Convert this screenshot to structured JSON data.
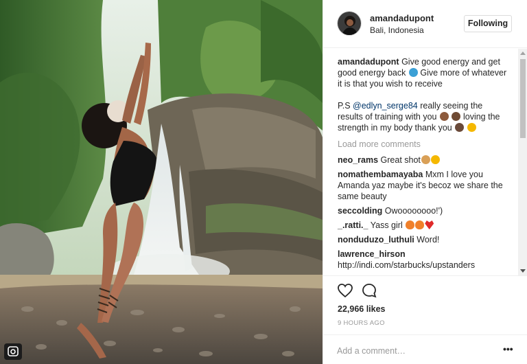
{
  "post": {
    "username": "amandadupont",
    "location": "Bali, Indonesia",
    "follow_label": "Following",
    "caption_line1": "Give good energy and get good energy back",
    "caption_line1b": "Give more of whatever it is that you wish to receive",
    "caption_p2_prefix": "P.S",
    "caption_mention": "@edlyn_serge84",
    "caption_p2_rest_a": "really seeing the results of training with you",
    "caption_p2_rest_b": "loving the strength in my body thank you",
    "load_more": "Load more comments",
    "likes": "22,966 likes",
    "time_ago": "9 HOURS AGO",
    "add_comment_placeholder": "Add a comment…",
    "more_label": "•••"
  },
  "comments": [
    {
      "user": "neo_rams",
      "text": "Great shot"
    },
    {
      "user": "nomathembamayaba",
      "text": "Mxm I love you Amanda yaz maybe it's becoz we share the same beauty"
    },
    {
      "user": "seccolding",
      "text": "Owoooooooo!')"
    },
    {
      "user": "_.ratti._",
      "text": "Yass girl"
    },
    {
      "user": "nonduduzo_luthuli",
      "text": "Word!"
    },
    {
      "user": "lawrence_hirson",
      "text": "http://indi.com/starbucks/upstanders"
    }
  ],
  "icons": {
    "heart": "heart-icon",
    "comment": "comment-icon",
    "camera_badge": "instagram-camera-icon"
  },
  "colors": {
    "text": "#262626",
    "muted": "#999999",
    "mention": "#003569",
    "border": "#efefef"
  }
}
